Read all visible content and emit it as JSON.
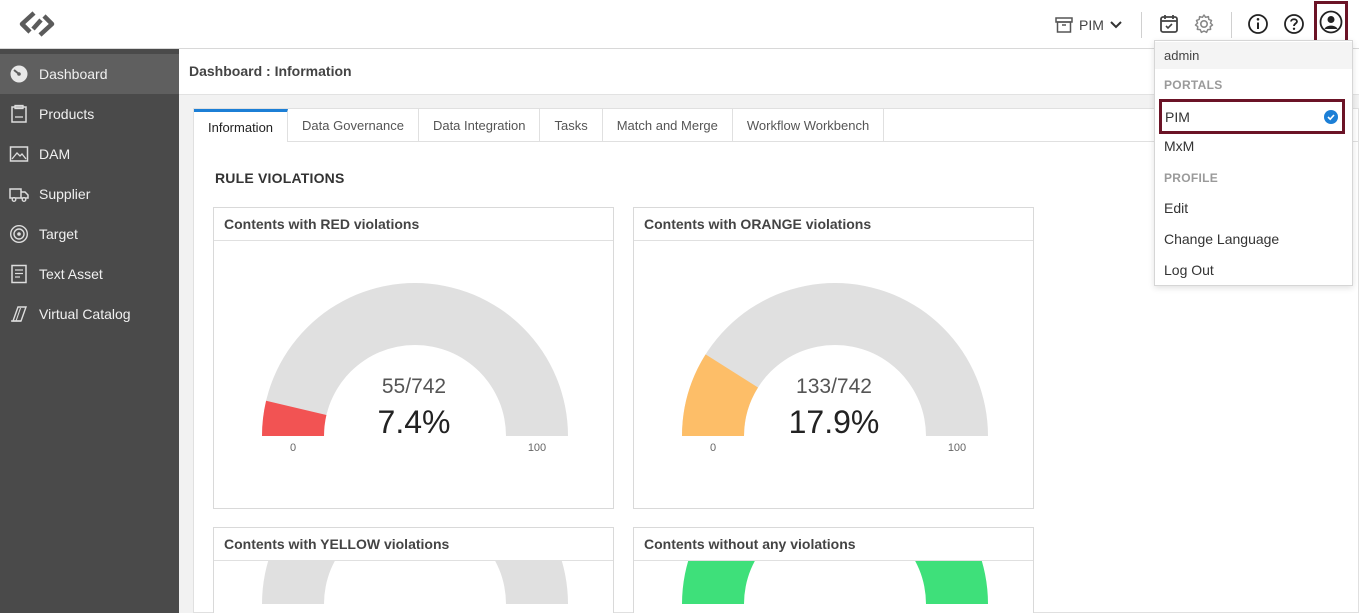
{
  "topbar": {
    "portal_label": "PIM",
    "icons": [
      "calendar-icon",
      "gear-icon",
      "info-icon",
      "help-icon",
      "user-icon"
    ]
  },
  "sidebar": {
    "items": [
      {
        "label": "Dashboard",
        "icon": "dashboard-icon",
        "active": true
      },
      {
        "label": "Products",
        "icon": "products-icon"
      },
      {
        "label": "DAM",
        "icon": "image-icon"
      },
      {
        "label": "Supplier",
        "icon": "truck-icon"
      },
      {
        "label": "Target",
        "icon": "target-icon"
      },
      {
        "label": "Text Asset",
        "icon": "document-icon"
      },
      {
        "label": "Virtual Catalog",
        "icon": "catalog-icon"
      }
    ]
  },
  "breadcrumb": "Dashboard : Information",
  "tabs": [
    "Information",
    "Data Governance",
    "Data Integration",
    "Tasks",
    "Match and Merge",
    "Workflow Workbench"
  ],
  "section_title": "RULE VIOLATIONS",
  "cards": [
    {
      "title": "Contents with RED violations",
      "fraction": "55/742",
      "percent": "7.4%",
      "value": 7.4,
      "color": "#f25353",
      "min": "0",
      "max": "100"
    },
    {
      "title": "Contents with ORANGE violations",
      "fraction": "133/742",
      "percent": "17.9%",
      "value": 17.9,
      "color": "#fdbe68",
      "min": "0",
      "max": "100"
    },
    {
      "title": "Contents with YELLOW violations"
    },
    {
      "title": "Contents without any violations"
    }
  ],
  "dropdown": {
    "user": "admin",
    "portals_heading": "PORTALS",
    "portals": [
      "PIM",
      "MxM"
    ],
    "profile_heading": "PROFILE",
    "profile_items": [
      "Edit",
      "Change Language",
      "Log Out"
    ]
  },
  "colors": {
    "accent": "#1c7fd6",
    "highlight": "#6b1326",
    "sidebar": "#4a4a4a",
    "gauge_track": "#e0e0e0",
    "green": "#3ee07a"
  }
}
